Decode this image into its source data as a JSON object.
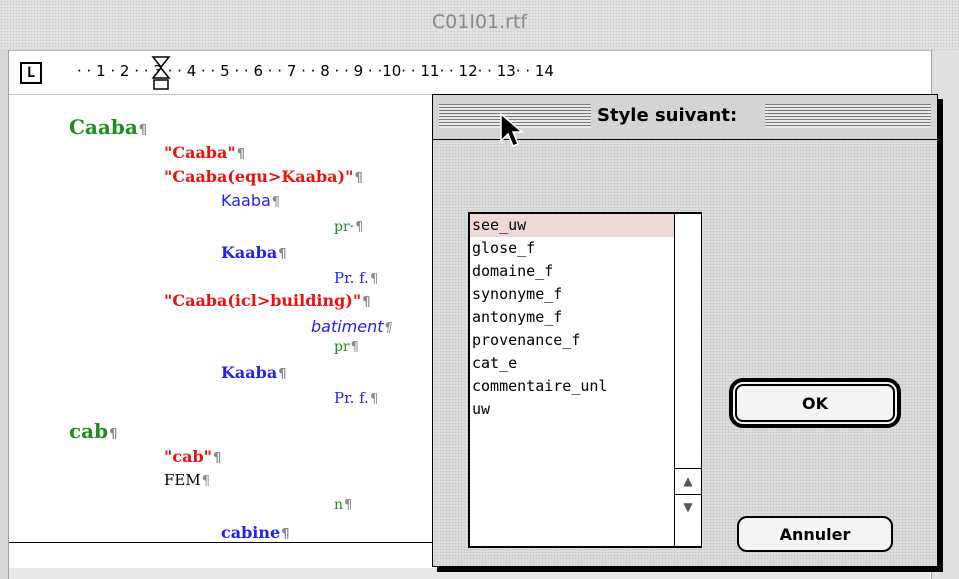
{
  "window": {
    "title": "C01I01.rtf",
    "tab_stop_button": "L",
    "ruler_scale": "· · 1 · 2 · · 3 · · 4 · · 5 · · 6 · · 7 · · 8 · · 9 · ·10· · 11· · 12· · 13· · 14"
  },
  "document": {
    "pilcrow": "¶",
    "lines": [
      {
        "text": "Caaba",
        "style": "headword",
        "color": "#1e8c1e"
      },
      {
        "text": "\"Caaba\"",
        "style": "quoted",
        "color": "#ee1111"
      },
      {
        "text": "\"Caaba(equ>Kaaba)\"",
        "style": "quoted",
        "color": "#ee1111"
      },
      {
        "text": "Kaaba",
        "style": "sans",
        "color": "#2222ee"
      },
      {
        "text": "pr·",
        "style": "pos",
        "color": "#1e8c1e"
      },
      {
        "text": "Kaaba",
        "style": "bold-serif",
        "color": "#2222ee"
      },
      {
        "text": "Pr. f.",
        "style": "serif",
        "color": "#2222ee"
      },
      {
        "text": "\"Caaba(icl>building)\"",
        "style": "quoted",
        "color": "#ee1111"
      },
      {
        "text": "batiment",
        "style": "italic-sans",
        "color": "#2222ee"
      },
      {
        "text": "pr",
        "style": "pos",
        "color": "#1e8c1e"
      },
      {
        "text": "Kaaba",
        "style": "bold-serif",
        "color": "#2222ee"
      },
      {
        "text": "Pr. f.",
        "style": "serif",
        "color": "#2222ee"
      },
      {
        "text": "cab",
        "style": "headword",
        "color": "#1e8c1e"
      },
      {
        "text": "\"cab\"",
        "style": "quoted",
        "color": "#ee1111"
      },
      {
        "text": "FEM",
        "style": "serif",
        "color": "#000000"
      },
      {
        "text": "n",
        "style": "pos",
        "color": "#1e8c1e"
      },
      {
        "text": "cabine",
        "style": "bold-serif",
        "color": "#2222ee"
      }
    ]
  },
  "dialog": {
    "title": "Style suivant:",
    "list": {
      "items": [
        "see_uw",
        "glose_f",
        "domaine_f",
        "synonyme_f",
        "antonyme_f",
        "provenance_f",
        "cat_e",
        "commentaire_unl",
        "uw"
      ],
      "selected_index": 0
    },
    "ok_label": "OK",
    "cancel_label": "Annuler"
  },
  "colors": {
    "headword": "#1e8c1e",
    "quoted": "#ee1111",
    "translation": "#2222ee",
    "selection": "#f1d8d8"
  },
  "icons": {
    "tab_stop": "tab-stop-icon",
    "ruler_indent_marker": "indent-marker-icon",
    "scroll_up": "arrow-up-icon",
    "scroll_down": "arrow-down-icon",
    "cursor": "mouse-pointer-icon"
  }
}
